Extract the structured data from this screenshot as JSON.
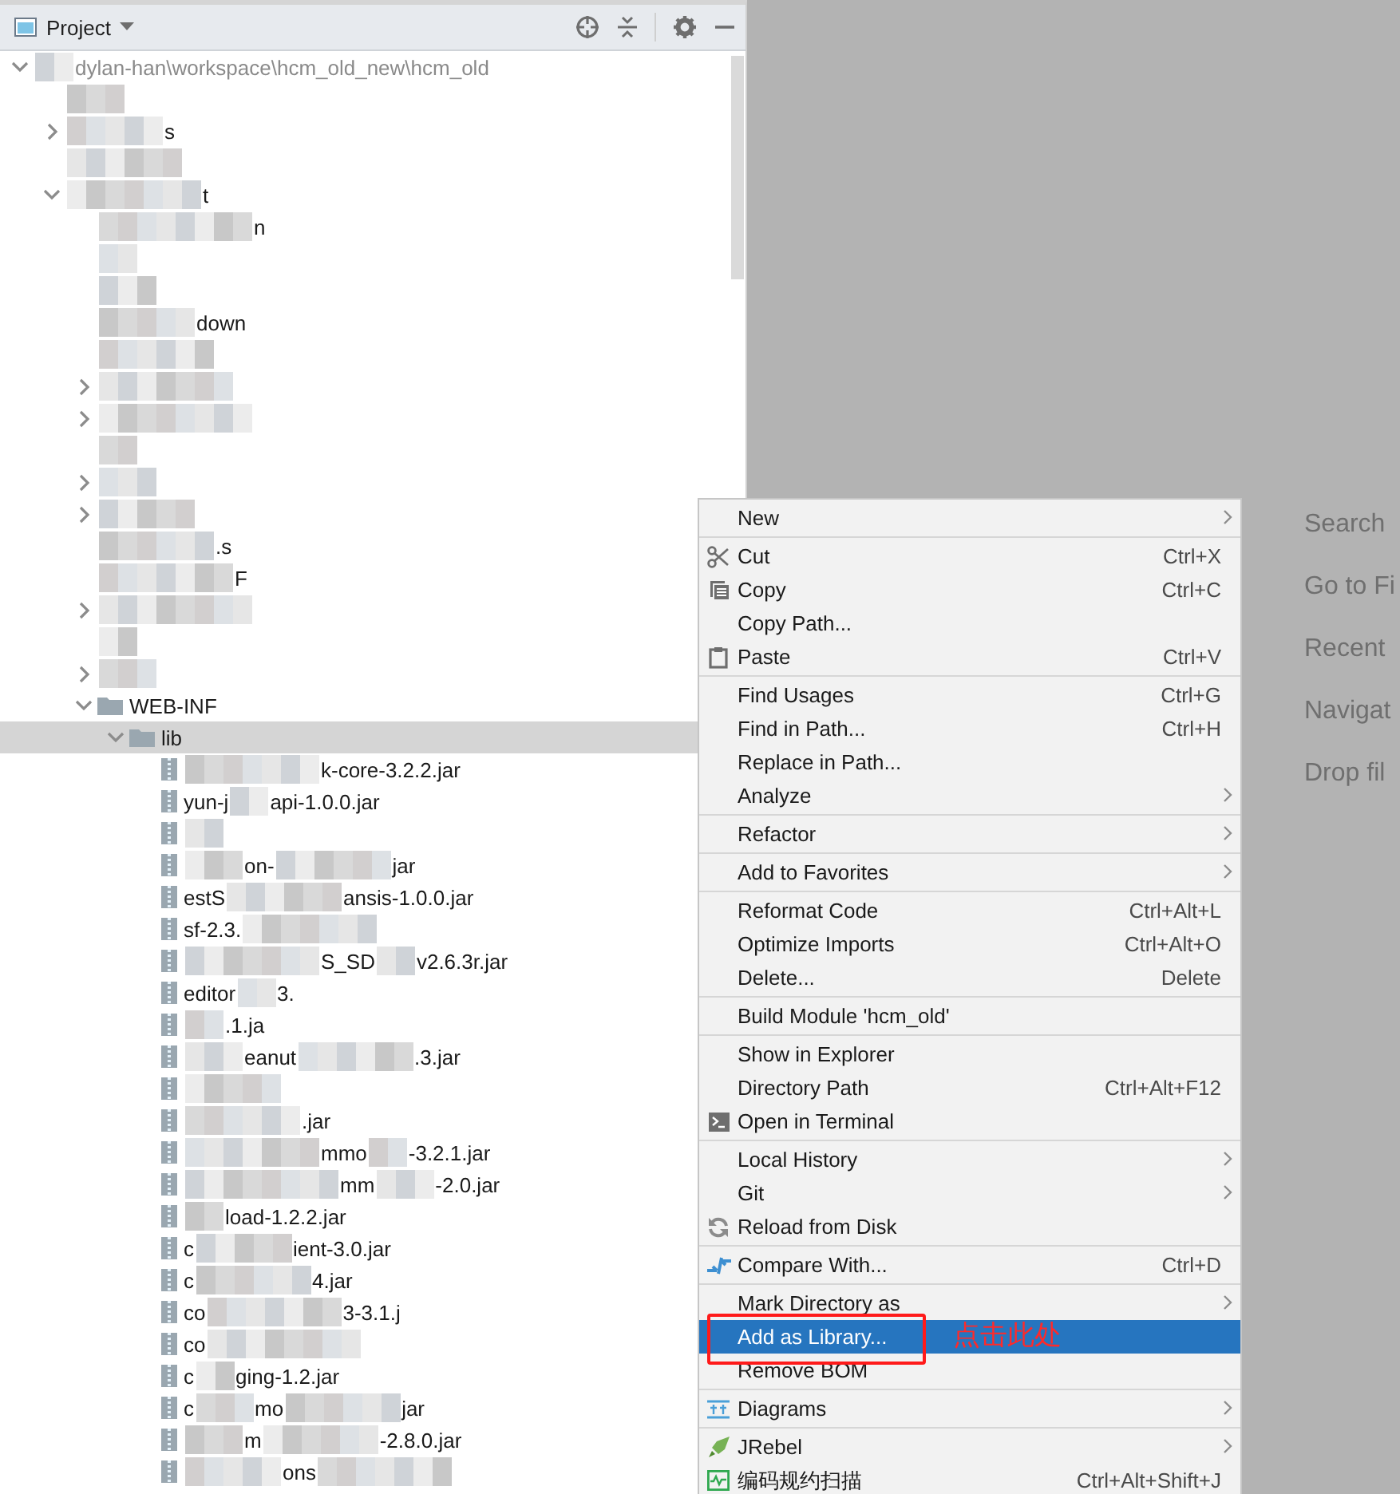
{
  "toolbar": {
    "title": "Project"
  },
  "tree": [
    {
      "kind": "module",
      "expanded": true,
      "selected": false,
      "parts": [
        {
          "kind": "blur"
        },
        {
          "text": "dylan-han\\workspace\\hcm_old_new\\hcm_old"
        }
      ],
      "children": [
        {
          "selected": false,
          "parts": [
            {
              "kind": "blur"
            }
          ]
        },
        {
          "expanded": false,
          "selected": false,
          "parts": [
            {
              "kind": "blur"
            },
            {
              "text": "s"
            }
          ]
        },
        {
          "selected": false,
          "parts": [
            {
              "kind": "blur"
            }
          ]
        },
        {
          "expanded": true,
          "selected": false,
          "parts": [
            {
              "kind": "blur"
            },
            {
              "text": "t"
            }
          ],
          "children": [
            {
              "selected": false,
              "parts": [
                {
                  "kind": "blur"
                },
                {
                  "text": "n"
                }
              ]
            },
            {
              "selected": false,
              "parts": [
                {
                  "kind": "blur"
                }
              ]
            },
            {
              "selected": false,
              "parts": [
                {
                  "kind": "blur"
                }
              ]
            },
            {
              "selected": false,
              "parts": [
                {
                  "kind": "blur"
                },
                {
                  "text": "down"
                }
              ]
            },
            {
              "selected": false,
              "parts": [
                {
                  "kind": "blur"
                }
              ]
            },
            {
              "expanded": false,
              "selected": false,
              "parts": [
                {
                  "kind": "blur"
                }
              ]
            },
            {
              "expanded": false,
              "selected": false,
              "parts": [
                {
                  "kind": "blur"
                }
              ]
            },
            {
              "selected": false,
              "parts": [
                {
                  "kind": "blur"
                }
              ]
            },
            {
              "expanded": false,
              "selected": false,
              "parts": [
                {
                  "kind": "blur"
                }
              ]
            },
            {
              "expanded": false,
              "selected": false,
              "parts": [
                {
                  "kind": "blur"
                }
              ]
            },
            {
              "selected": false,
              "parts": [
                {
                  "kind": "blur"
                },
                {
                  "text": ".s"
                }
              ]
            },
            {
              "selected": false,
              "parts": [
                {
                  "kind": "blur"
                },
                {
                  "text": "F"
                }
              ]
            },
            {
              "expanded": false,
              "selected": false,
              "parts": [
                {
                  "kind": "blur"
                }
              ]
            },
            {
              "selected": false,
              "parts": [
                {
                  "kind": "blur"
                }
              ]
            },
            {
              "expanded": false,
              "selected": false,
              "parts": [
                {
                  "kind": "blur"
                }
              ]
            },
            {
              "kind": "folder",
              "expanded": true,
              "selected": false,
              "parts": [
                {
                  "text": "WEB-INF"
                }
              ],
              "children": [
                {
                  "kind": "folder",
                  "expanded": true,
                  "selected": true,
                  "parts": [
                    {
                      "text": "lib"
                    }
                  ],
                  "children": [
                    {
                      "kind": "jar",
                      "selected": false,
                      "parts": [
                        {
                          "kind": "blur"
                        },
                        {
                          "text": "k-core-3.2.2.jar"
                        }
                      ]
                    },
                    {
                      "kind": "jar",
                      "selected": false,
                      "parts": [
                        {
                          "text": "yun-j"
                        },
                        {
                          "kind": "blur"
                        },
                        {
                          "text": "api-1.0.0.jar"
                        }
                      ]
                    },
                    {
                      "kind": "jar",
                      "selected": false,
                      "parts": [
                        {
                          "kind": "blur"
                        }
                      ]
                    },
                    {
                      "kind": "jar",
                      "selected": false,
                      "parts": [
                        {
                          "kind": "blur"
                        },
                        {
                          "text": "on-"
                        },
                        {
                          "kind": "blur"
                        },
                        {
                          "text": "jar"
                        }
                      ]
                    },
                    {
                      "kind": "jar",
                      "selected": false,
                      "parts": [
                        {
                          "text": "estS"
                        },
                        {
                          "kind": "blur"
                        },
                        {
                          "text": "ansis-1.0.0.jar"
                        }
                      ]
                    },
                    {
                      "kind": "jar",
                      "selected": false,
                      "parts": [
                        {
                          "text": "sf-2.3."
                        },
                        {
                          "kind": "blur"
                        }
                      ]
                    },
                    {
                      "kind": "jar",
                      "selected": false,
                      "parts": [
                        {
                          "kind": "blur"
                        },
                        {
                          "text": "S_SD"
                        },
                        {
                          "kind": "blur"
                        },
                        {
                          "text": "v2.6.3r.jar"
                        }
                      ]
                    },
                    {
                      "kind": "jar",
                      "selected": false,
                      "parts": [
                        {
                          "text": "editor"
                        },
                        {
                          "kind": "blur"
                        },
                        {
                          "text": "3."
                        }
                      ]
                    },
                    {
                      "kind": "jar",
                      "selected": false,
                      "parts": [
                        {
                          "kind": "blur"
                        },
                        {
                          "text": ".1.ja"
                        }
                      ]
                    },
                    {
                      "kind": "jar",
                      "selected": false,
                      "parts": [
                        {
                          "kind": "blur"
                        },
                        {
                          "text": "eanut"
                        },
                        {
                          "kind": "blur"
                        },
                        {
                          "text": ".3.jar"
                        }
                      ]
                    },
                    {
                      "kind": "jar",
                      "selected": false,
                      "parts": [
                        {
                          "kind": "blur"
                        }
                      ]
                    },
                    {
                      "kind": "jar",
                      "selected": false,
                      "parts": [
                        {
                          "kind": "blur"
                        },
                        {
                          "text": ".jar"
                        }
                      ]
                    },
                    {
                      "kind": "jar",
                      "selected": false,
                      "parts": [
                        {
                          "kind": "blur"
                        },
                        {
                          "text": "mmo"
                        },
                        {
                          "kind": "blur"
                        },
                        {
                          "text": "-3.2.1.jar"
                        }
                      ]
                    },
                    {
                      "kind": "jar",
                      "selected": false,
                      "parts": [
                        {
                          "kind": "blur"
                        },
                        {
                          "text": "mm"
                        },
                        {
                          "kind": "blur"
                        },
                        {
                          "text": "-2.0.jar"
                        }
                      ]
                    },
                    {
                      "kind": "jar",
                      "selected": false,
                      "parts": [
                        {
                          "kind": "blur"
                        },
                        {
                          "text": "load-1.2.2.jar"
                        }
                      ]
                    },
                    {
                      "kind": "jar",
                      "selected": false,
                      "parts": [
                        {
                          "text": "c"
                        },
                        {
                          "kind": "blur"
                        },
                        {
                          "text": "ient-3.0.jar"
                        }
                      ]
                    },
                    {
                      "kind": "jar",
                      "selected": false,
                      "parts": [
                        {
                          "text": "c"
                        },
                        {
                          "kind": "blur"
                        },
                        {
                          "text": "4.jar"
                        }
                      ]
                    },
                    {
                      "kind": "jar",
                      "selected": false,
                      "parts": [
                        {
                          "text": "co"
                        },
                        {
                          "kind": "blur"
                        },
                        {
                          "text": "3-3.1.j"
                        }
                      ]
                    },
                    {
                      "kind": "jar",
                      "selected": false,
                      "parts": [
                        {
                          "text": "co"
                        },
                        {
                          "kind": "blur"
                        }
                      ]
                    },
                    {
                      "kind": "jar",
                      "selected": false,
                      "parts": [
                        {
                          "text": "c"
                        },
                        {
                          "kind": "blur"
                        },
                        {
                          "text": "ging-1.2.jar"
                        }
                      ]
                    },
                    {
                      "kind": "jar",
                      "selected": false,
                      "parts": [
                        {
                          "text": "c"
                        },
                        {
                          "kind": "blur"
                        },
                        {
                          "text": "mo"
                        },
                        {
                          "kind": "blur"
                        },
                        {
                          "text": "jar"
                        }
                      ]
                    },
                    {
                      "kind": "jar",
                      "selected": false,
                      "parts": [
                        {
                          "kind": "blur"
                        },
                        {
                          "text": "m"
                        },
                        {
                          "kind": "blur"
                        },
                        {
                          "text": "-2.8.0.jar"
                        }
                      ]
                    },
                    {
                      "kind": "jar",
                      "selected": false,
                      "parts": [
                        {
                          "kind": "blur"
                        },
                        {
                          "text": "ons"
                        },
                        {
                          "kind": "blur"
                        }
                      ]
                    }
                  ]
                }
              ]
            }
          ]
        }
      ]
    }
  ],
  "editor_hints": [
    "Search",
    "Go to Fi",
    "Recent",
    "Navigat",
    "Drop fil"
  ],
  "context_menu": {
    "groups": [
      {
        "items": [
          {
            "label": "New",
            "submenu": true,
            "selected": false
          }
        ]
      },
      {
        "items": [
          {
            "label": "Cut",
            "kind": "scissors",
            "shortcut": "Ctrl+X",
            "submenu": false,
            "selected": false
          },
          {
            "label": "Copy",
            "kind": "copy",
            "shortcut": "Ctrl+C",
            "submenu": false,
            "selected": false
          },
          {
            "label": "Copy Path...",
            "submenu": false,
            "selected": false
          },
          {
            "label": "Paste",
            "kind": "paste",
            "shortcut": "Ctrl+V",
            "submenu": false,
            "selected": false
          }
        ]
      },
      {
        "items": [
          {
            "label": "Find Usages",
            "shortcut": "Ctrl+G",
            "submenu": false,
            "selected": false
          },
          {
            "label": "Find in Path...",
            "shortcut": "Ctrl+H",
            "submenu": false,
            "selected": false
          },
          {
            "label": "Replace in Path...",
            "submenu": false,
            "selected": false
          },
          {
            "label": "Analyze",
            "submenu": true,
            "selected": false
          }
        ]
      },
      {
        "items": [
          {
            "label": "Refactor",
            "submenu": true,
            "selected": false
          }
        ]
      },
      {
        "items": [
          {
            "label": "Add to Favorites",
            "submenu": true,
            "selected": false
          }
        ]
      },
      {
        "items": [
          {
            "label": "Reformat Code",
            "shortcut": "Ctrl+Alt+L",
            "submenu": false,
            "selected": false
          },
          {
            "label": "Optimize Imports",
            "shortcut": "Ctrl+Alt+O",
            "submenu": false,
            "selected": false
          },
          {
            "label": "Delete...",
            "shortcut": "Delete",
            "submenu": false,
            "selected": false
          }
        ]
      },
      {
        "items": [
          {
            "label": "Build Module 'hcm_old'",
            "submenu": false,
            "selected": false
          }
        ]
      },
      {
        "items": [
          {
            "label": "Show in Explorer",
            "submenu": false,
            "selected": false
          },
          {
            "label": "Directory Path",
            "shortcut": "Ctrl+Alt+F12",
            "submenu": false,
            "selected": false
          },
          {
            "label": "Open in Terminal",
            "kind": "terminal",
            "submenu": false,
            "selected": false
          }
        ]
      },
      {
        "items": [
          {
            "label": "Local History",
            "submenu": true,
            "selected": false
          },
          {
            "label": "Git",
            "submenu": true,
            "selected": false
          },
          {
            "label": "Reload from Disk",
            "kind": "reload",
            "submenu": false,
            "selected": false
          }
        ]
      },
      {
        "items": [
          {
            "label": "Compare With...",
            "kind": "compare",
            "shortcut": "Ctrl+D",
            "submenu": false,
            "selected": false
          }
        ]
      },
      {
        "items": [
          {
            "label": "Mark Directory as",
            "submenu": true,
            "selected": false
          },
          {
            "label": "Add as Library...",
            "submenu": false,
            "selected": true
          },
          {
            "label": "Remove BOM",
            "submenu": false,
            "selected": false
          }
        ]
      },
      {
        "items": [
          {
            "label": "Diagrams",
            "kind": "diagram",
            "submenu": true,
            "selected": false
          }
        ]
      },
      {
        "items": [
          {
            "label": "JRebel",
            "kind": "jrebel",
            "submenu": true,
            "selected": false
          },
          {
            "label": "编码规约扫描",
            "kind": "scan",
            "shortcut": "Ctrl+Alt+Shift+J",
            "submenu": false,
            "selected": false
          }
        ]
      }
    ]
  },
  "annotation": {
    "text": "点击此处"
  }
}
